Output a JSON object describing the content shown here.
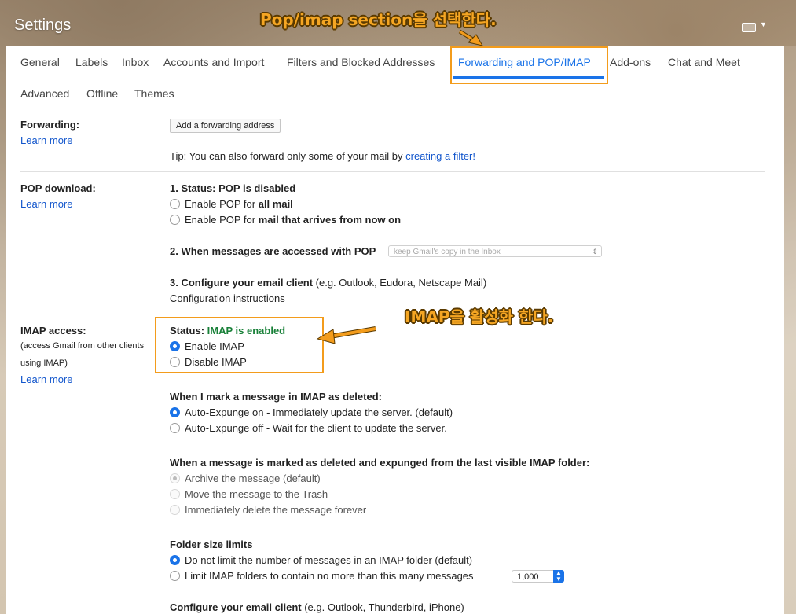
{
  "header": {
    "title": "Settings"
  },
  "tabs": [
    {
      "label": "General"
    },
    {
      "label": "Labels"
    },
    {
      "label": "Inbox"
    },
    {
      "label": "Accounts and Import"
    },
    {
      "label": "Filters and Blocked Addresses"
    },
    {
      "label": "Forwarding and POP/IMAP",
      "active": true
    },
    {
      "label": "Add-ons"
    },
    {
      "label": "Chat and Meet"
    },
    {
      "label": "Advanced"
    },
    {
      "label": "Offline"
    },
    {
      "label": "Themes"
    }
  ],
  "forwarding": {
    "label": "Forwarding:",
    "learn_more": "Learn more",
    "add_button": "Add a forwarding address",
    "tip_prefix": "Tip: You can also forward only some of your mail by ",
    "tip_link": "creating a filter!"
  },
  "pop": {
    "label": "POP download:",
    "learn_more": "Learn more",
    "status": "1. Status: POP is disabled",
    "option_all_prefix": "Enable POP for ",
    "option_all_bold": "all mail",
    "option_now_prefix": "Enable POP for ",
    "option_now_bold": "mail that arrives from now on",
    "when_accessed": "2. When messages are accessed with POP",
    "select_value": "keep Gmail's copy in the Inbox",
    "configure_bold": "3. Configure your email client",
    "configure_rest": " (e.g. Outlook, Eudora, Netscape Mail)",
    "config_link": "Configuration instructions"
  },
  "imap": {
    "label": "IMAP access:",
    "desc_line1": "(access Gmail from other clients",
    "desc_line2": "using IMAP)",
    "learn_more": "Learn more",
    "status_prefix": "Status: ",
    "status_value": "IMAP is enabled",
    "enable": "Enable IMAP",
    "disable": "Disable IMAP",
    "deleted_heading": "When I mark a message in IMAP as deleted:",
    "expunge_on": "Auto-Expunge on - Immediately update the server. (default)",
    "expunge_off": "Auto-Expunge off - Wait for the client to update the server.",
    "expunged_heading": "When a message is marked as deleted and expunged from the last visible IMAP folder:",
    "archive": "Archive the message (default)",
    "trash": "Move the message to the Trash",
    "delete_forever": "Immediately delete the message forever",
    "folder_heading": "Folder size limits",
    "no_limit": "Do not limit the number of messages in an IMAP folder (default)",
    "limit": "Limit IMAP folders to contain no more than this many messages",
    "limit_value": "1,000",
    "configure_bold": "Configure your email client",
    "configure_rest": " (e.g. Outlook, Thunderbird, iPhone)"
  },
  "annotations": {
    "tab_note": "Pop/imap section을 선택한다.",
    "imap_note": "IMAP을 활성화 한다."
  },
  "colors": {
    "accent": "#1a73e8",
    "link": "#1155cc",
    "enabled": "#188038",
    "annotation": "#f5a623"
  }
}
